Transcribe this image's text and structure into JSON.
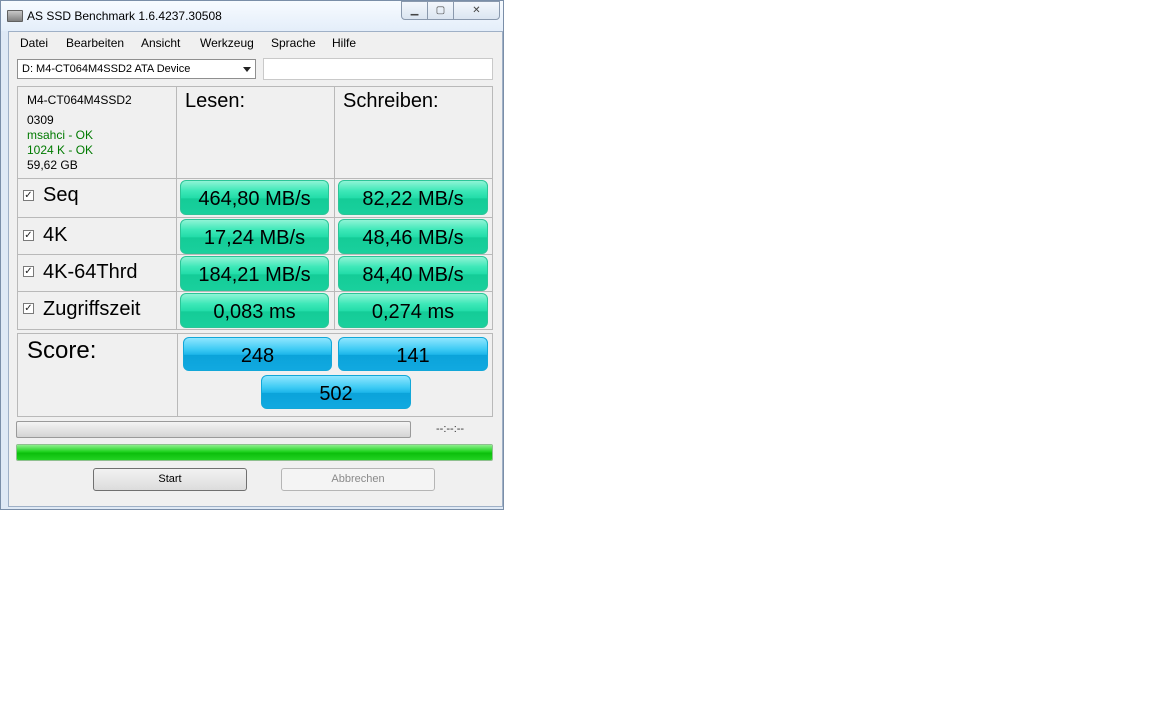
{
  "window": {
    "title": "AS SSD Benchmark 1.6.4237.30508"
  },
  "menu": [
    "Datei",
    "Bearbeiten",
    "Ansicht",
    "Werkzeug",
    "Sprache",
    "Hilfe"
  ],
  "device_select": {
    "value": "D: M4-CT064M4SSD2 ATA Device"
  },
  "drive_info": {
    "model": "M4-CT064M4SSD2",
    "firmware": "0309",
    "driver": "msahci - OK",
    "alignment": "1024 K - OK",
    "capacity": "59,62 GB"
  },
  "columns": {
    "read": "Lesen:",
    "write": "Schreiben:"
  },
  "rows": [
    {
      "label": "Seq",
      "checked": true,
      "read": "464,80 MB/s",
      "write": "82,22 MB/s"
    },
    {
      "label": "4K",
      "checked": true,
      "read": "17,24 MB/s",
      "write": "48,46 MB/s"
    },
    {
      "label": "4K-64Thrd",
      "checked": true,
      "read": "184,21 MB/s",
      "write": "84,40 MB/s"
    },
    {
      "label": "Zugriffszeit",
      "checked": true,
      "read": "0,083 ms",
      "write": "0,274 ms"
    }
  ],
  "score": {
    "label": "Score:",
    "read": "248",
    "write": "141",
    "total": "502"
  },
  "progress": {
    "time": "--:--:--",
    "bar_fraction": 1.0
  },
  "buttons": {
    "start": "Start",
    "cancel": "Abbrechen"
  },
  "colors": {
    "value_tile": "#22dca8",
    "score_tile": "#1db6ea",
    "ok_text": "#007a00",
    "progress": "#1ed21e"
  }
}
